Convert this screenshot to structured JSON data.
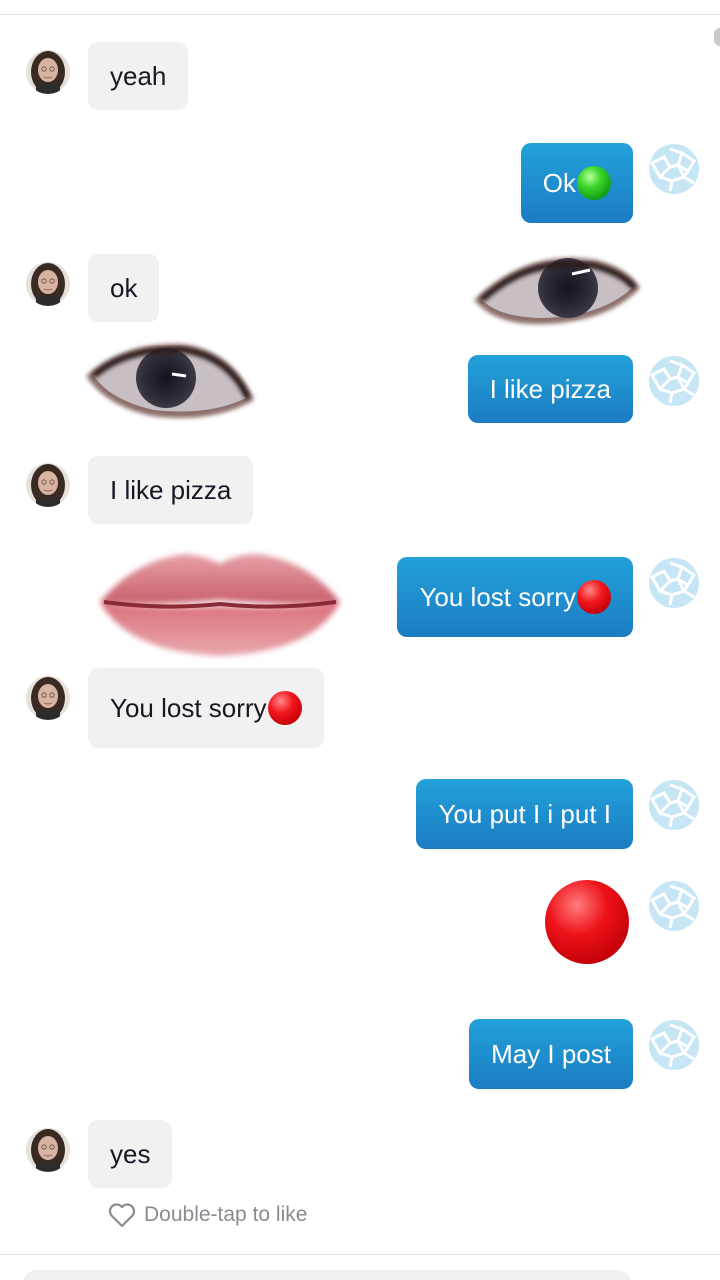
{
  "messages": [
    {
      "text": "yeah"
    },
    {
      "text": "Ok"
    },
    {
      "text": "ok"
    },
    {
      "text": "I like pizza"
    },
    {
      "text": "I like pizza"
    },
    {
      "text": "You lost sorry"
    },
    {
      "text": "You lost sorry"
    },
    {
      "text": "You put I i put I"
    },
    {
      "text": "May I post"
    },
    {
      "text": "yes"
    }
  ],
  "footer": {
    "like_hint": "Double-tap to like"
  },
  "icons": {
    "like": "heart-outline-icon",
    "green_emoji": "green-circle-emoji",
    "red_emoji": "red-circle-emoji"
  },
  "colors": {
    "outgoing_bubble": "#1e90cf",
    "incoming_bubble": "#f1f1f2",
    "hint_text": "#8a8b91"
  }
}
